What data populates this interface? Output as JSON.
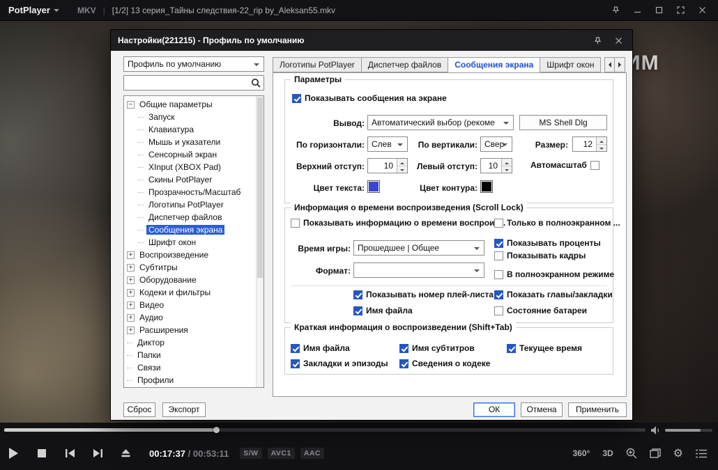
{
  "window": {
    "app_name": "PotPlayer",
    "format_badge": "MKV",
    "separator": "|",
    "title": "[1/2] 13 серия_Тайны следствия-22_rip by_Aleksan55.mkv",
    "watermark": "ИМ"
  },
  "dialog": {
    "title": "Настройки(221215) - Профиль по умолчанию",
    "profile_dropdown": {
      "value": "Профиль по умолчанию"
    },
    "search": {
      "value": "",
      "placeholder": ""
    },
    "tree": {
      "items": [
        {
          "id": "general",
          "label": "Общие параметры",
          "level": 0,
          "expand": "minus"
        },
        {
          "id": "startup",
          "label": "Запуск",
          "level": 1
        },
        {
          "id": "keyboard",
          "label": "Клавиатура",
          "level": 1
        },
        {
          "id": "mouse",
          "label": "Мышь и указатели",
          "level": 1
        },
        {
          "id": "touch",
          "label": "Сенсорный экран",
          "level": 1
        },
        {
          "id": "xinput",
          "label": "XInput (XBOX Pad)",
          "level": 1
        },
        {
          "id": "skins",
          "label": "Скины PotPlayer",
          "level": 1
        },
        {
          "id": "transparency",
          "label": "Прозрачность/Масштаб",
          "level": 1
        },
        {
          "id": "logos",
          "label": "Логотипы PotPlayer",
          "level": 1
        },
        {
          "id": "file-manager",
          "label": "Диспетчер файлов",
          "level": 1
        },
        {
          "id": "osd",
          "label": "Сообщения экрана",
          "level": 1,
          "selected": true
        },
        {
          "id": "window-font",
          "label": "Шрифт окон",
          "level": 1
        },
        {
          "id": "playback",
          "label": "Воспроизведение",
          "level": 0,
          "expand": "plus"
        },
        {
          "id": "subtitles",
          "label": "Субтитры",
          "level": 0,
          "expand": "plus"
        },
        {
          "id": "hardware",
          "label": "Оборудование",
          "level": 0,
          "expand": "plus"
        },
        {
          "id": "codecs",
          "label": "Кодеки и фильтры",
          "level": 0,
          "expand": "plus"
        },
        {
          "id": "video",
          "label": "Видео",
          "level": 0,
          "expand": "plus"
        },
        {
          "id": "audio",
          "label": "Аудио",
          "level": 0,
          "expand": "plus"
        },
        {
          "id": "extensions",
          "label": "Расширения",
          "level": 0,
          "expand": "plus"
        },
        {
          "id": "narrator",
          "label": "Диктор",
          "level": 0
        },
        {
          "id": "folders",
          "label": "Папки",
          "level": 0
        },
        {
          "id": "associations",
          "label": "Связи",
          "level": 0
        },
        {
          "id": "profiles",
          "label": "Профили",
          "level": 0
        }
      ]
    },
    "tabs": [
      {
        "id": "logos",
        "label": "Логотипы PotPlayer"
      },
      {
        "id": "file-manager",
        "label": "Диспетчер файлов"
      },
      {
        "id": "osd",
        "label": "Сообщения экрана",
        "active": true
      },
      {
        "id": "window-font",
        "label": "Шрифт окон"
      }
    ],
    "params": {
      "title": "Параметры",
      "show_messages": {
        "label": "Показывать сообщения на экране",
        "checked": true
      },
      "output_label": "Вывод:",
      "output_value": "Автоматический выбор (рекоме",
      "font_button": "MS Shell Dlg",
      "horizontal_label": "По горизонтали:",
      "horizontal_value": "Слев",
      "vertical_label": "По вертикали:",
      "vertical_value": "Свер",
      "size_label": "Размер:",
      "size_value": "12",
      "top_margin_label": "Верхний отступ:",
      "top_margin_value": "10",
      "left_margin_label": "Левый отступ:",
      "left_margin_value": "10",
      "autoscale": {
        "label": "Автомасштаб",
        "checked": false
      },
      "text_color_label": "Цвет текста:",
      "text_color": "#3a45d1",
      "outline_color_label": "Цвет контура:",
      "outline_color": "#000000"
    },
    "time_info": {
      "title": "Информация о времени воспроизведения (Scroll Lock)",
      "show_info": {
        "label": "Показывать информацию о времени воспроиз...",
        "checked": false
      },
      "fullscreen_only": {
        "label": "Только в полноэкранном ...",
        "checked": false
      },
      "play_time_label": "Время игры:",
      "play_time_value": "Прошедшее | Общее",
      "show_percent": {
        "label": "Показывать проценты",
        "checked": true
      },
      "show_frames": {
        "label": "Показывать кадры",
        "checked": false
      },
      "format_label": "Формат:",
      "format_value": "",
      "fullscreen_mode": {
        "label": "В полноэкранном режиме",
        "checked": false
      },
      "playlist_number": {
        "label": "Показывать номер плей-листа",
        "checked": true
      },
      "chapters": {
        "label": "Показать главы/закладки",
        "checked": true
      },
      "file_name": {
        "label": "Имя файла",
        "checked": true
      },
      "battery": {
        "label": "Состояние батареи",
        "checked": false
      }
    },
    "brief_info": {
      "title": "Краткая информация о воспроизведении (Shift+Tab)",
      "file_name": {
        "label": "Имя файла",
        "checked": true
      },
      "subtitle_name": {
        "label": "Имя субтитров",
        "checked": true
      },
      "current_time": {
        "label": "Текущее время",
        "checked": true
      },
      "bookmarks": {
        "label": "Закладки и эпизоды",
        "checked": true
      },
      "codec_info": {
        "label": "Сведения о кодеке",
        "checked": true
      }
    },
    "buttons": {
      "reset": "Сброс",
      "export": "Экспорт",
      "ok": "ОК",
      "cancel": "Отмена",
      "apply": "Применить"
    }
  },
  "player": {
    "seek_percent": 33,
    "volume_percent": 75,
    "time_current": "00:17:37",
    "time_separator": "/",
    "time_total": "00:53:11",
    "badges": [
      "S/W",
      "AVC1",
      "AAC"
    ],
    "icon_labels": {
      "vr": "360°",
      "three_d": "3D"
    }
  }
}
